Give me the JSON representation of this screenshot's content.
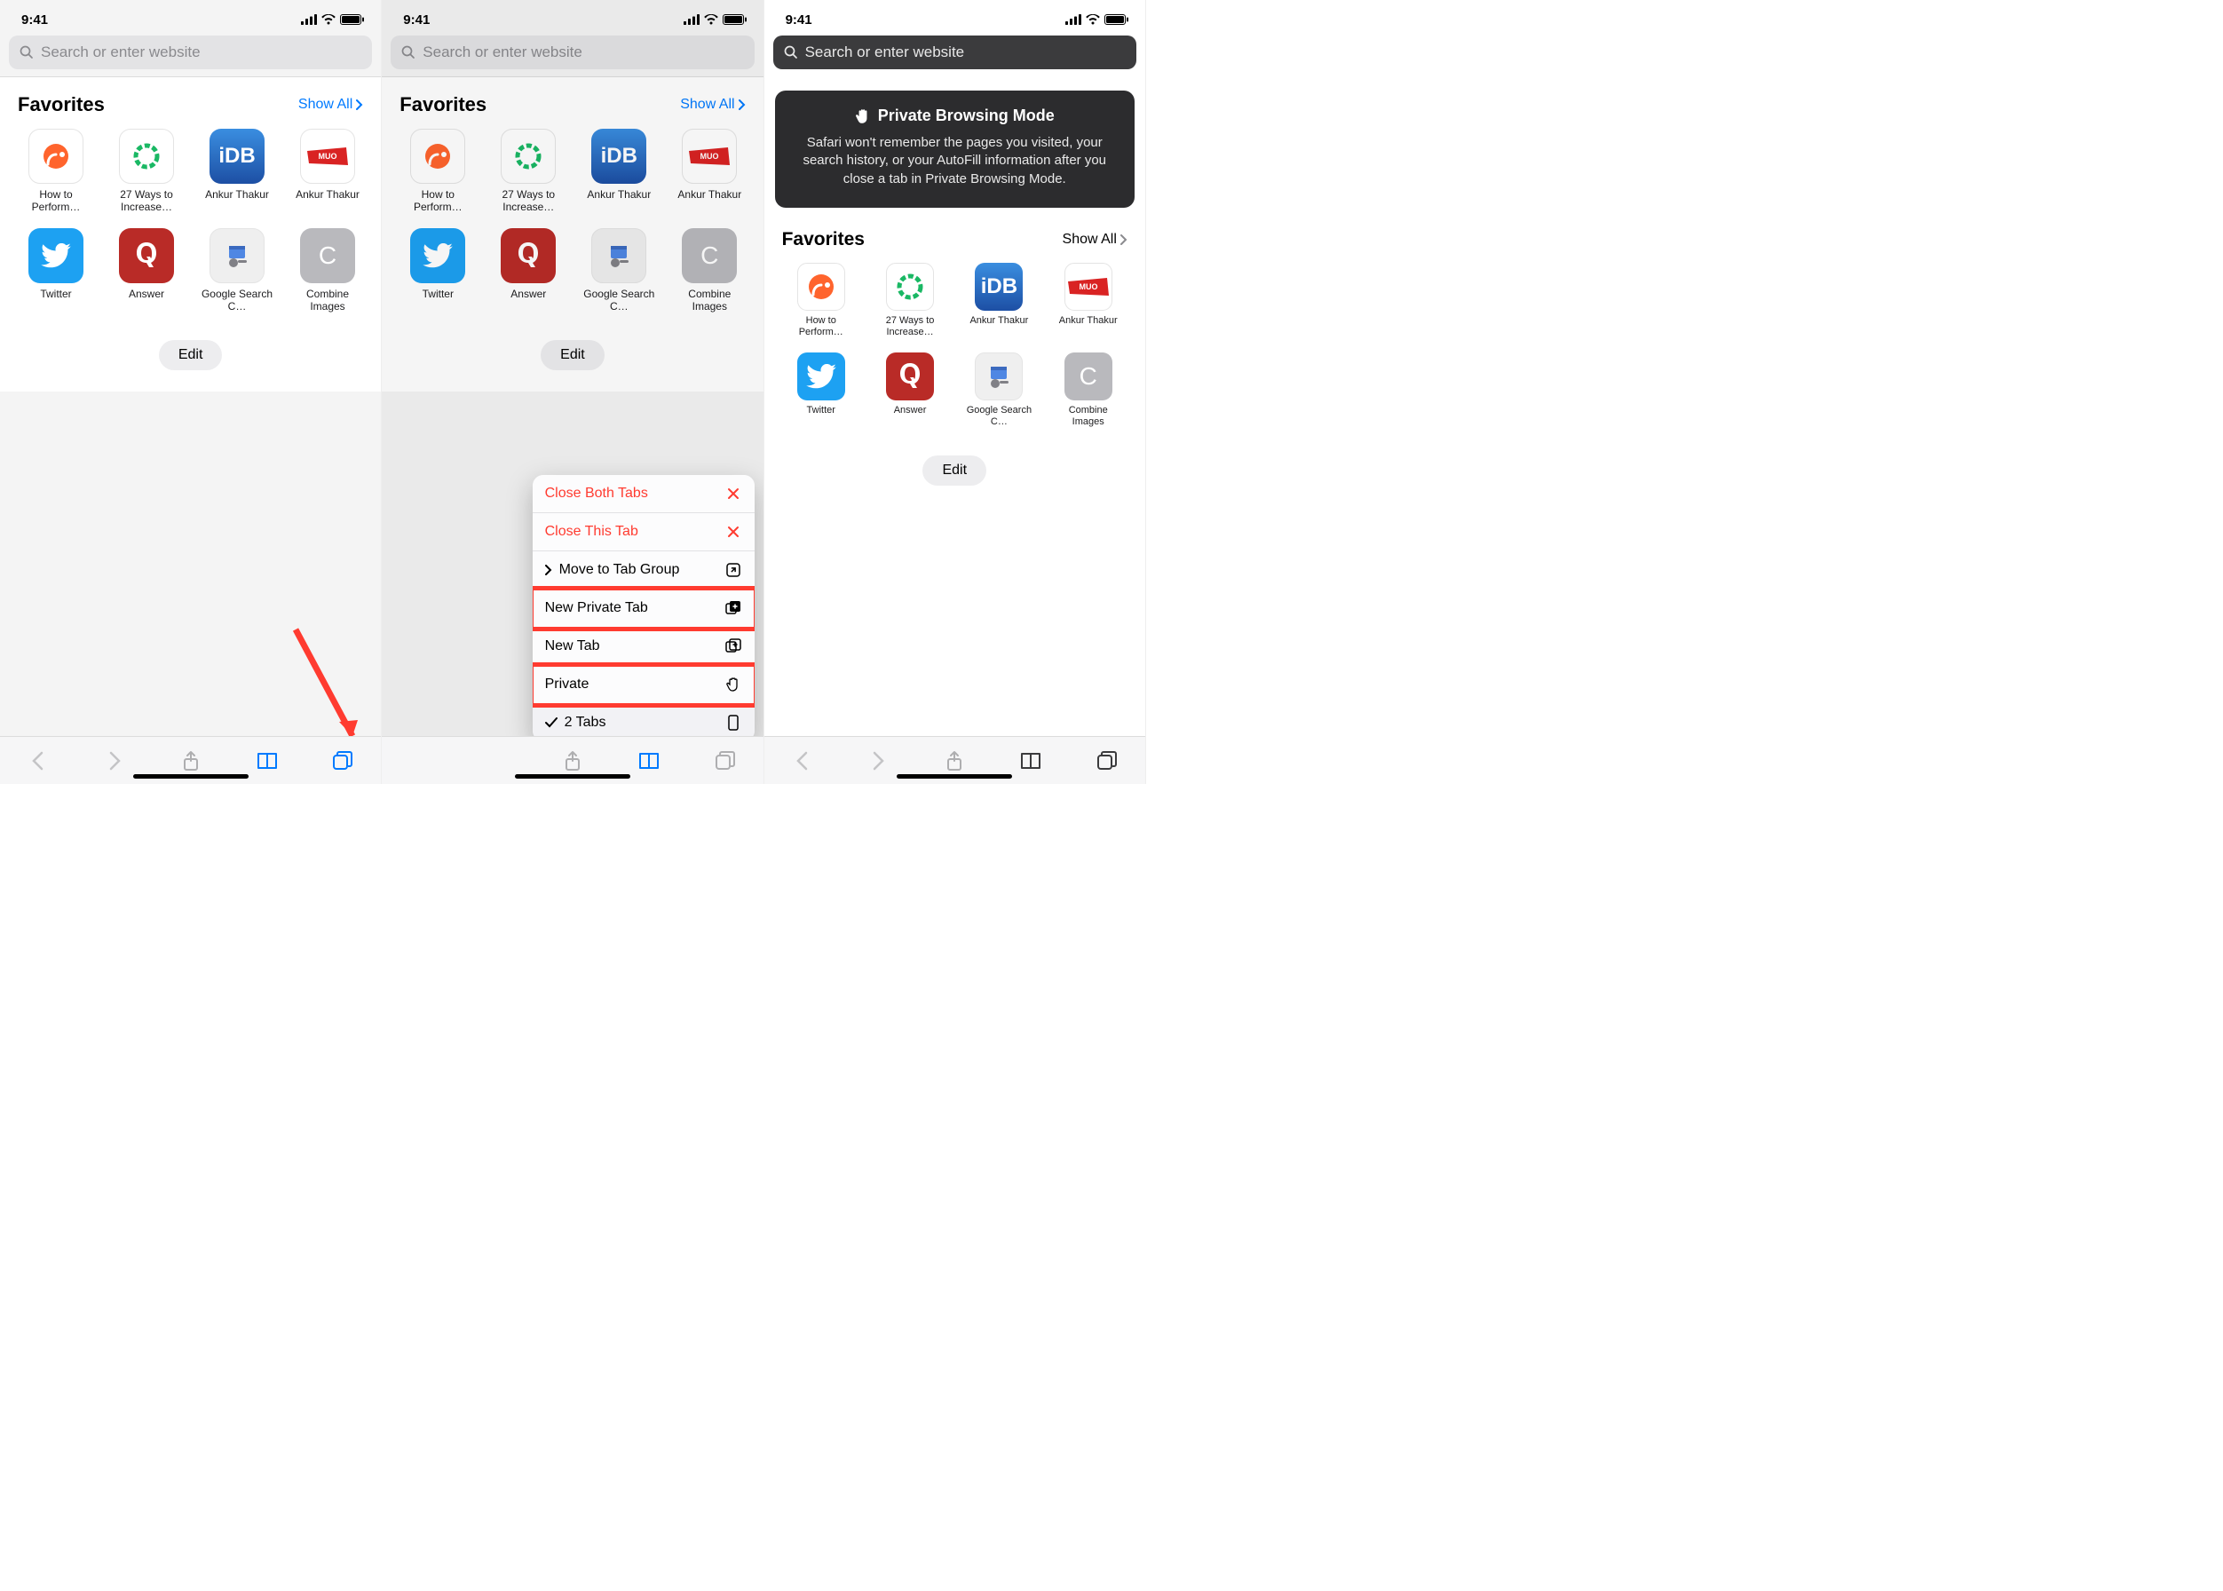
{
  "time": "9:41",
  "search_placeholder": "Search or enter website",
  "favorites_title": "Favorites",
  "show_all": "Show All",
  "edit": "Edit",
  "favorites": [
    {
      "label": "How to Perform…",
      "icon": "semrush"
    },
    {
      "label": "27 Ways to Increase…",
      "icon": "circle"
    },
    {
      "label": "Ankur Thakur",
      "icon": "idb"
    },
    {
      "label": "Ankur Thakur",
      "icon": "muo"
    },
    {
      "label": "Twitter",
      "icon": "twitter"
    },
    {
      "label": "Answer",
      "icon": "quora"
    },
    {
      "label": "Google Search C…",
      "icon": "google"
    },
    {
      "label": "Combine Images",
      "icon": "combine"
    }
  ],
  "menu": {
    "close_both": "Close Both Tabs",
    "close_this": "Close This Tab",
    "move_group": "Move to Tab Group",
    "new_private": "New Private Tab",
    "new_tab": "New Tab",
    "private": "Private",
    "tabs": "2 Tabs"
  },
  "private_mode": {
    "title": "Private Browsing Mode",
    "desc": "Safari won't remember the pages you visited, your search history, or your AutoFill information after you close a tab in Private Browsing Mode."
  }
}
